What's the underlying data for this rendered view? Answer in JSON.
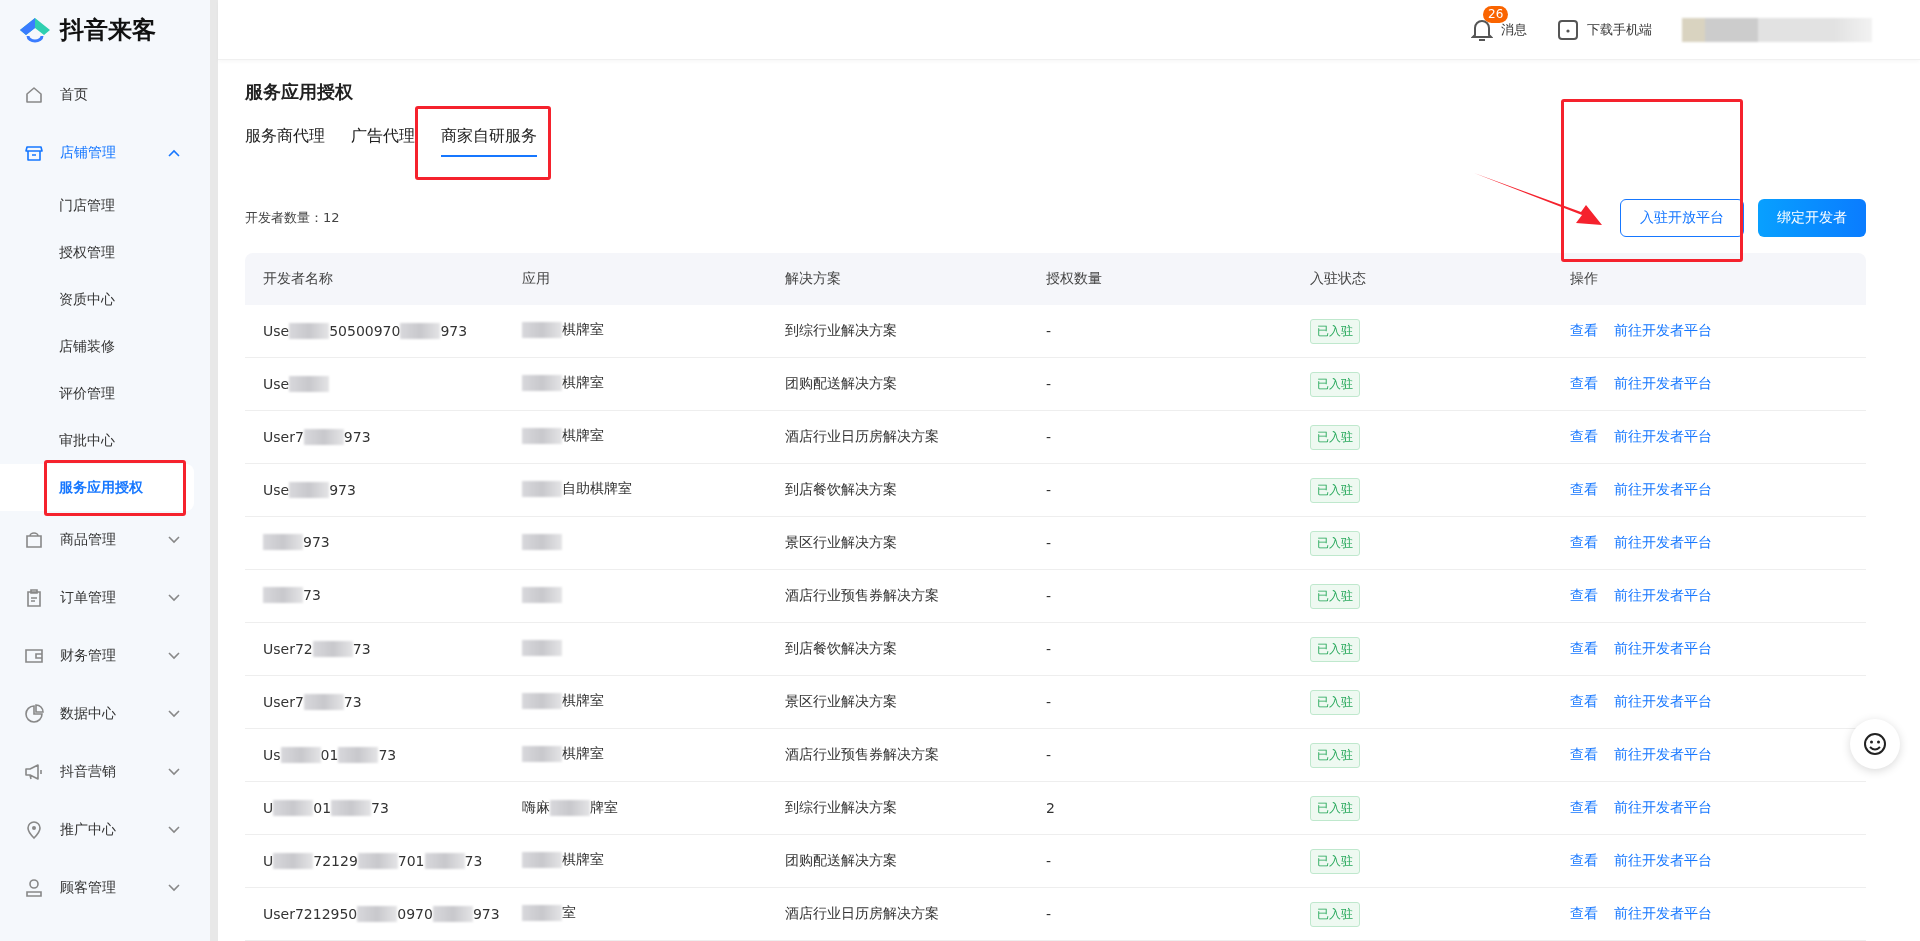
{
  "brand": {
    "name": "抖音来客"
  },
  "sidebar": {
    "items": [
      {
        "label": "首页",
        "selected": false
      },
      {
        "label": "店铺管理",
        "selected": false,
        "expanded": true,
        "children": [
          {
            "label": "门店管理",
            "selected": false
          },
          {
            "label": "授权管理",
            "selected": false
          },
          {
            "label": "资质中心",
            "selected": false
          },
          {
            "label": "店铺装修",
            "selected": false
          },
          {
            "label": "评价管理",
            "selected": false
          },
          {
            "label": "审批中心",
            "selected": false
          },
          {
            "label": "服务应用授权",
            "selected": true,
            "annotated": true
          }
        ]
      },
      {
        "label": "商品管理",
        "selected": false,
        "expanded": false
      },
      {
        "label": "订单管理",
        "selected": false,
        "expanded": false
      },
      {
        "label": "财务管理",
        "selected": false,
        "expanded": false
      },
      {
        "label": "数据中心",
        "selected": false,
        "expanded": false
      },
      {
        "label": "抖音营销",
        "selected": false,
        "expanded": false
      },
      {
        "label": "推广中心",
        "selected": false,
        "expanded": false
      },
      {
        "label": "顾客管理",
        "selected": false,
        "expanded": false
      }
    ]
  },
  "header": {
    "messages": {
      "label": "消息",
      "badge": "26"
    },
    "download": {
      "label": "下载手机端"
    }
  },
  "page": {
    "title": "服务应用授权",
    "tabs": [
      {
        "label": "服务商代理",
        "selected": false,
        "annotated": false
      },
      {
        "label": "广告代理",
        "selected": false,
        "annotated": false
      },
      {
        "label": "商家自研服务",
        "selected": true,
        "annotated": true
      }
    ],
    "developer_count": "开发者数量：12",
    "buttons": [
      {
        "label": "入驻开放平台",
        "kind": "outline",
        "annotated": true
      },
      {
        "label": "绑定开发者",
        "kind": "primary",
        "annotated": false
      }
    ],
    "table": {
      "columns": [
        "开发者名称",
        "应用",
        "解决方案",
        "授权数量",
        "入驻状态",
        "操作"
      ],
      "rows": [
        {
          "developer": [
            {
              "kind": "text",
              "text": "Use"
            },
            {
              "kind": "blur"
            },
            {
              "kind": "text",
              "text": "50500970"
            },
            {
              "kind": "blur"
            },
            {
              "kind": "text",
              "text": "973"
            }
          ],
          "app": [
            {
              "kind": "blur"
            },
            {
              "kind": "text",
              "text": "棋牌室"
            }
          ],
          "solution": "到综行业解决方案",
          "count": "-",
          "status": "已入驻",
          "actions": [
            "查看",
            "前往开发者平台"
          ]
        },
        {
          "developer": [
            {
              "kind": "text",
              "text": "Use"
            },
            {
              "kind": "blur"
            }
          ],
          "app": [
            {
              "kind": "blur"
            },
            {
              "kind": "text",
              "text": "棋牌室"
            }
          ],
          "solution": "团购配送解决方案",
          "count": "-",
          "status": "已入驻",
          "actions": [
            "查看",
            "前往开发者平台"
          ]
        },
        {
          "developer": [
            {
              "kind": "text",
              "text": "User7"
            },
            {
              "kind": "blur"
            },
            {
              "kind": "text",
              "text": "973"
            }
          ],
          "app": [
            {
              "kind": "blur"
            },
            {
              "kind": "text",
              "text": "棋牌室"
            }
          ],
          "solution": "酒店行业日历房解决方案",
          "count": "-",
          "status": "已入驻",
          "actions": [
            "查看",
            "前往开发者平台"
          ]
        },
        {
          "developer": [
            {
              "kind": "text",
              "text": "Use"
            },
            {
              "kind": "blur"
            },
            {
              "kind": "text",
              "text": "973"
            }
          ],
          "app": [
            {
              "kind": "blur"
            },
            {
              "kind": "text",
              "text": "自助棋牌室"
            }
          ],
          "solution": "到店餐饮解决方案",
          "count": "-",
          "status": "已入驻",
          "actions": [
            "查看",
            "前往开发者平台"
          ]
        },
        {
          "developer": [
            {
              "kind": "blur"
            },
            {
              "kind": "text",
              "text": "973"
            }
          ],
          "app": [
            {
              "kind": "blur"
            }
          ],
          "solution": "景区行业解决方案",
          "count": "-",
          "status": "已入驻",
          "actions": [
            "查看",
            "前往开发者平台"
          ]
        },
        {
          "developer": [
            {
              "kind": "blur"
            },
            {
              "kind": "text",
              "text": "73"
            }
          ],
          "app": [
            {
              "kind": "blur"
            }
          ],
          "solution": "酒店行业预售券解决方案",
          "count": "-",
          "status": "已入驻",
          "actions": [
            "查看",
            "前往开发者平台"
          ]
        },
        {
          "developer": [
            {
              "kind": "text",
              "text": "User72"
            },
            {
              "kind": "blur"
            },
            {
              "kind": "text",
              "text": "73"
            }
          ],
          "app": [
            {
              "kind": "blur"
            }
          ],
          "solution": "到店餐饮解决方案",
          "count": "-",
          "status": "已入驻",
          "actions": [
            "查看",
            "前往开发者平台"
          ]
        },
        {
          "developer": [
            {
              "kind": "text",
              "text": "User7"
            },
            {
              "kind": "blur"
            },
            {
              "kind": "text",
              "text": "73"
            }
          ],
          "app": [
            {
              "kind": "blur"
            },
            {
              "kind": "text",
              "text": "棋牌室"
            }
          ],
          "solution": "景区行业解决方案",
          "count": "-",
          "status": "已入驻",
          "actions": [
            "查看",
            "前往开发者平台"
          ]
        },
        {
          "developer": [
            {
              "kind": "text",
              "text": "Us"
            },
            {
              "kind": "blur"
            },
            {
              "kind": "text",
              "text": "01"
            },
            {
              "kind": "blur"
            },
            {
              "kind": "text",
              "text": "73"
            }
          ],
          "app": [
            {
              "kind": "blur"
            },
            {
              "kind": "text",
              "text": "棋牌室"
            }
          ],
          "solution": "酒店行业预售券解决方案",
          "count": "-",
          "status": "已入驻",
          "actions": [
            "查看",
            "前往开发者平台"
          ]
        },
        {
          "developer": [
            {
              "kind": "text",
              "text": "U"
            },
            {
              "kind": "blur"
            },
            {
              "kind": "text",
              "text": "01"
            },
            {
              "kind": "blur"
            },
            {
              "kind": "text",
              "text": "73"
            }
          ],
          "app": [
            {
              "kind": "text",
              "text": "嗨麻"
            },
            {
              "kind": "blur"
            },
            {
              "kind": "text",
              "text": "牌室"
            }
          ],
          "solution": "到综行业解决方案",
          "count": "2",
          "status": "已入驻",
          "actions": [
            "查看",
            "前往开发者平台"
          ]
        },
        {
          "developer": [
            {
              "kind": "text",
              "text": "U"
            },
            {
              "kind": "blur"
            },
            {
              "kind": "text",
              "text": "72129"
            },
            {
              "kind": "blur"
            },
            {
              "kind": "text",
              "text": "701"
            },
            {
              "kind": "blur"
            },
            {
              "kind": "text",
              "text": "73"
            }
          ],
          "app": [
            {
              "kind": "blur"
            },
            {
              "kind": "text",
              "text": "棋牌室"
            }
          ],
          "solution": "团购配送解决方案",
          "count": "-",
          "status": "已入驻",
          "actions": [
            "查看",
            "前往开发者平台"
          ]
        },
        {
          "developer": [
            {
              "kind": "text",
              "text": "User7212950"
            },
            {
              "kind": "blur"
            },
            {
              "kind": "text",
              "text": "0970"
            },
            {
              "kind": "blur"
            },
            {
              "kind": "text",
              "text": "973"
            }
          ],
          "app": [
            {
              "kind": "blur"
            },
            {
              "kind": "text",
              "text": "室"
            }
          ],
          "solution": "酒店行业日历房解决方案",
          "count": "-",
          "status": "已入驻",
          "actions": [
            "查看",
            "前往开发者平台"
          ]
        }
      ]
    }
  }
}
